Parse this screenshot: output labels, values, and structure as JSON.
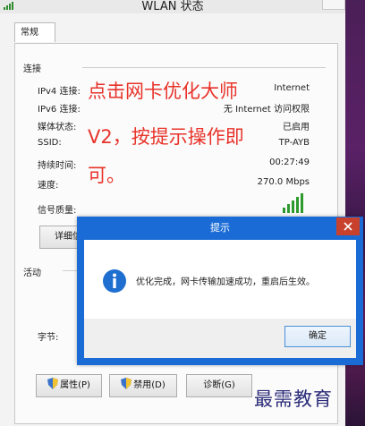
{
  "window": {
    "title": "WLAN 状态"
  },
  "tabs": [
    {
      "label": "常规"
    }
  ],
  "connection": {
    "section_label": "连接",
    "rows": [
      {
        "label": "IPv4 连接:",
        "value": "Internet"
      },
      {
        "label": "IPv6 连接:",
        "value": "无 Internet 访问权限"
      },
      {
        "label": "媒体状态:",
        "value": "已启用"
      },
      {
        "label": "SSID:",
        "value": "TP-AYB"
      },
      {
        "label": "持续时间:",
        "value": "00:27:49"
      },
      {
        "label": "速度:",
        "value": "270.0 Mbps"
      }
    ],
    "signal_label": "信号质量:",
    "signal_bars": 5,
    "details_button": "详细信"
  },
  "activity": {
    "section_label": "活动",
    "bytes_label": "字节:"
  },
  "buttons": {
    "properties": "属性(P)",
    "disable": "禁用(D)",
    "diagnose": "诊断(G)"
  },
  "overlay": {
    "lines": [
      "点击网卡优化大师",
      "V2，按提示操作即",
      "可。"
    ],
    "color": "#e8332a"
  },
  "watermark": "最需教育",
  "dialog": {
    "title": "提示",
    "message": "优化完成，网卡传输加速成功，重启后生效。",
    "ok_label": "确定",
    "accent": "#1a6bd6"
  }
}
